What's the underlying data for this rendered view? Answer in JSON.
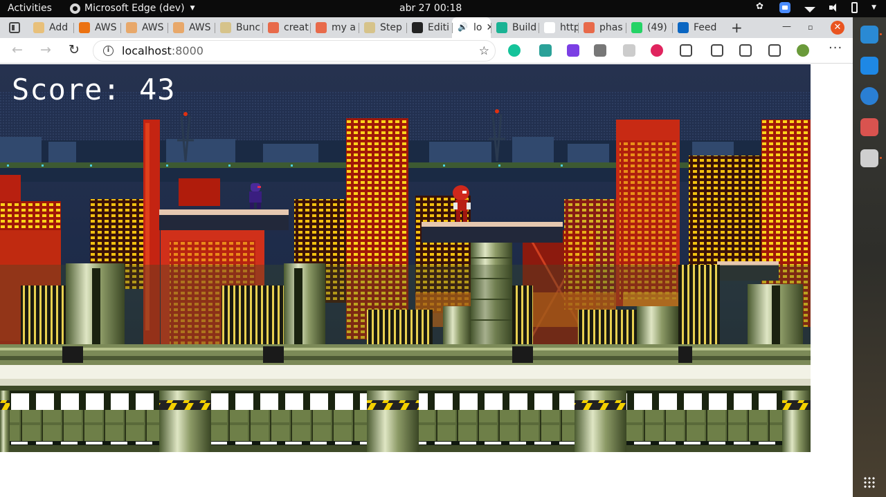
{
  "topbar": {
    "activities": "Activities",
    "app_name": "Microsoft Edge (dev)",
    "clock": "abr 27  00:18"
  },
  "tabs": [
    {
      "title": "Add",
      "favicon": "doc-icon",
      "color": "#e8c07a"
    },
    {
      "title": "AWS",
      "favicon": "aws-icon",
      "color": "#ec7211"
    },
    {
      "title": "AWS",
      "favicon": "aws-icon",
      "color": "#e8a86a"
    },
    {
      "title": "AWS",
      "favicon": "aws-icon",
      "color": "#e8a86a"
    },
    {
      "title": "Bunc",
      "favicon": "doc-icon",
      "color": "#d6c38a"
    },
    {
      "title": "creat",
      "favicon": "gitbook-icon",
      "color": "#e86a4a"
    },
    {
      "title": "my a",
      "favicon": "gitbook-icon",
      "color": "#e86a4a"
    },
    {
      "title": "Step",
      "favicon": "doc-icon",
      "color": "#d6c38a"
    },
    {
      "title": "Editi",
      "favicon": "github-icon",
      "color": "#222222"
    },
    {
      "title": "lo",
      "favicon": "speaker-icon",
      "color": "#ffffff",
      "active": true
    },
    {
      "title": "Build",
      "favicon": "diamond-icon",
      "color": "#1ab394"
    },
    {
      "title": "https",
      "favicon": "page-icon",
      "color": "#ffffff"
    },
    {
      "title": "phas",
      "favicon": "gitbook-icon",
      "color": "#e86a4a"
    },
    {
      "title": "(49)",
      "favicon": "whatsapp-icon",
      "color": "#25d366"
    },
    {
      "title": "Feed",
      "favicon": "linkedin-icon",
      "color": "#0a66c2"
    }
  ],
  "toolbar": {
    "url_host": "localhost",
    "url_port": ":8000"
  },
  "extensions": [
    {
      "name": "grammarly-icon",
      "color": "#15c39a"
    },
    {
      "name": "tool-icon",
      "color": "#2aa198"
    },
    {
      "name": "puzzle-badge-icon",
      "color": "#7b3fe4"
    },
    {
      "name": "layers-icon",
      "color": "#777777"
    },
    {
      "name": "screen-icon",
      "color": "#cccccc"
    },
    {
      "name": "block-icon",
      "color": "#e0245e"
    },
    {
      "name": "extensions-icon",
      "color": "#444444"
    },
    {
      "name": "favorites-icon",
      "color": "#444444"
    },
    {
      "name": "collections-icon",
      "color": "#444444"
    },
    {
      "name": "share-icon",
      "color": "#444444"
    },
    {
      "name": "profile-avatar",
      "color": "#6a9a3a"
    }
  ],
  "game": {
    "score_text": "Score: 43"
  },
  "dock": [
    {
      "name": "edge-dev-icon",
      "color": "#2a8ad4"
    },
    {
      "name": "vscode-icon",
      "color": "#1e88e5"
    },
    {
      "name": "help-icon",
      "color": "#2a7fd4"
    },
    {
      "name": "system-monitor-icon",
      "color": "#d9534f"
    },
    {
      "name": "files-icon",
      "color": "#cfcfcf"
    }
  ]
}
